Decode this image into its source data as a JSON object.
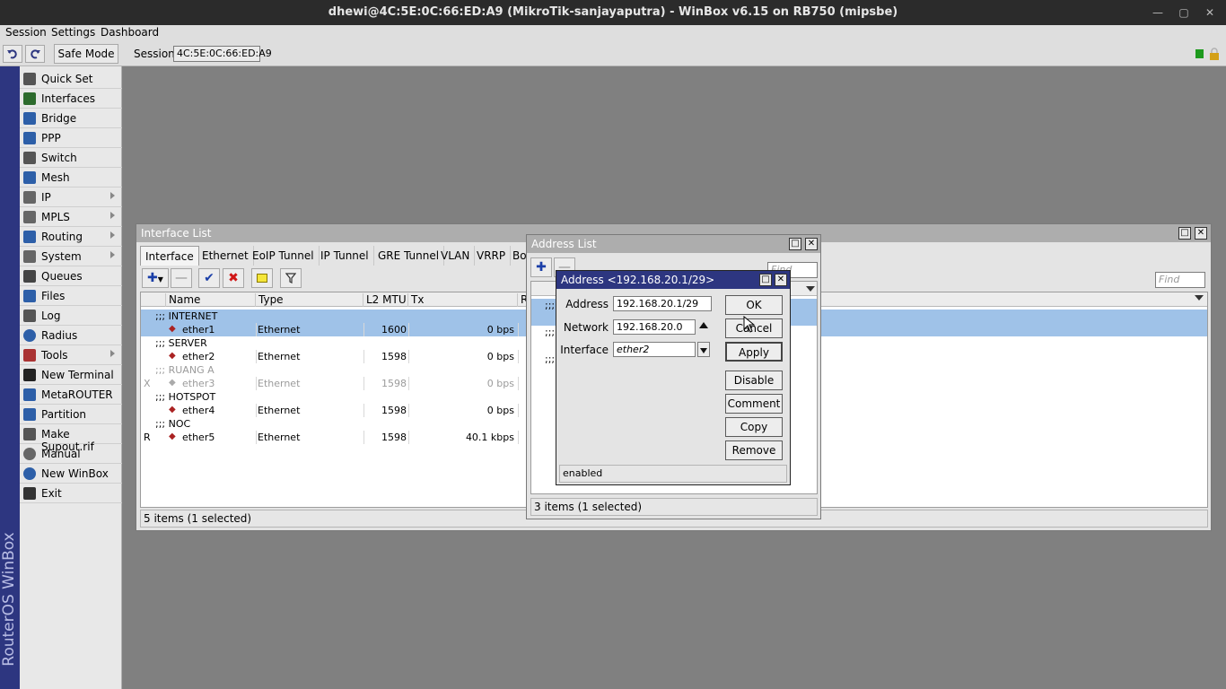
{
  "window": {
    "title": "dhewi@4C:5E:0C:66:ED:A9 (MikroTik-sanjayaputra) - WinBox v6.15 on RB750 (mipsbe)"
  },
  "menubar": [
    "Session",
    "Settings",
    "Dashboard"
  ],
  "toolbar": {
    "safe_mode": "Safe Mode",
    "session_label": "Session:",
    "session_value": "4C:5E:0C:66:ED:A9"
  },
  "sidebar": {
    "brand": "RouterOS WinBox",
    "items": [
      {
        "label": "Quick Set",
        "icon": "magic-wand-icon",
        "submenu": false
      },
      {
        "label": "Interfaces",
        "icon": "interfaces-icon",
        "submenu": false
      },
      {
        "label": "Bridge",
        "icon": "bridge-icon",
        "submenu": false
      },
      {
        "label": "PPP",
        "icon": "ppp-icon",
        "submenu": false
      },
      {
        "label": "Switch",
        "icon": "switch-icon",
        "submenu": false
      },
      {
        "label": "Mesh",
        "icon": "mesh-icon",
        "submenu": false
      },
      {
        "label": "IP",
        "icon": "ip-icon",
        "submenu": true
      },
      {
        "label": "MPLS",
        "icon": "mpls-icon",
        "submenu": true
      },
      {
        "label": "Routing",
        "icon": "routing-icon",
        "submenu": true
      },
      {
        "label": "System",
        "icon": "gear-icon",
        "submenu": true
      },
      {
        "label": "Queues",
        "icon": "queues-icon",
        "submenu": false
      },
      {
        "label": "Files",
        "icon": "folder-icon",
        "submenu": false
      },
      {
        "label": "Log",
        "icon": "log-icon",
        "submenu": false
      },
      {
        "label": "Radius",
        "icon": "radius-icon",
        "submenu": false
      },
      {
        "label": "Tools",
        "icon": "tools-icon",
        "submenu": true
      },
      {
        "label": "New Terminal",
        "icon": "terminal-icon",
        "submenu": false
      },
      {
        "label": "MetaROUTER",
        "icon": "metarouter-icon",
        "submenu": false
      },
      {
        "label": "Partition",
        "icon": "partition-icon",
        "submenu": false
      },
      {
        "label": "Make Supout.rif",
        "icon": "supout-icon",
        "submenu": false
      },
      {
        "label": "Manual",
        "icon": "manual-icon",
        "submenu": false
      },
      {
        "label": "New WinBox",
        "icon": "winbox-icon",
        "submenu": false
      },
      {
        "label": "Exit",
        "icon": "exit-icon",
        "submenu": false
      }
    ]
  },
  "interface_list": {
    "title": "Interface List",
    "tabs": [
      "Interface",
      "Ethernet",
      "EoIP Tunnel",
      "IP Tunnel",
      "GRE Tunnel",
      "VLAN",
      "VRRP",
      "Bo"
    ],
    "find_placeholder": "Find",
    "columns": [
      "Name",
      "Type",
      "L2 MTU",
      "Tx",
      "R"
    ],
    "rows": [
      {
        "kind": "comment",
        "text": ";;; INTERNET",
        "selected": true
      },
      {
        "kind": "data",
        "flag": "",
        "name": "ether1",
        "type": "Ethernet",
        "mtu": "1600",
        "tx": "0 bps",
        "selected": true,
        "disabled": false
      },
      {
        "kind": "comment",
        "text": ";;; SERVER",
        "selected": false
      },
      {
        "kind": "data",
        "flag": "",
        "name": "ether2",
        "type": "Ethernet",
        "mtu": "1598",
        "tx": "0 bps",
        "selected": false,
        "disabled": false
      },
      {
        "kind": "comment",
        "text": ";;; RUANG A",
        "selected": false,
        "disabled": true
      },
      {
        "kind": "data",
        "flag": "X",
        "name": "ether3",
        "type": "Ethernet",
        "mtu": "1598",
        "tx": "0 bps",
        "selected": false,
        "disabled": true
      },
      {
        "kind": "comment",
        "text": ";;; HOTSPOT",
        "selected": false
      },
      {
        "kind": "data",
        "flag": "",
        "name": "ether4",
        "type": "Ethernet",
        "mtu": "1598",
        "tx": "0 bps",
        "selected": false,
        "disabled": false
      },
      {
        "kind": "comment",
        "text": ";;; NOC",
        "selected": false
      },
      {
        "kind": "data",
        "flag": "R",
        "name": "ether5",
        "type": "Ethernet",
        "mtu": "1598",
        "tx": "40.1 kbps",
        "selected": false,
        "disabled": false
      }
    ],
    "status": "5 items (1 selected)"
  },
  "address_list": {
    "title": "Address List",
    "find_placeholder": "Find",
    "status": "3 items (1 selected)",
    "comment_marker": ";;;"
  },
  "address_dialog": {
    "title": "Address <192.168.20.1/29>",
    "address_label": "Address",
    "address_value": "192.168.20.1/29",
    "network_label": "Network",
    "network_value": "192.168.20.0",
    "interface_label": "Interface",
    "interface_value": "ether2",
    "buttons": [
      "OK",
      "Cancel",
      "Apply",
      "Disable",
      "Comment",
      "Copy",
      "Remove"
    ],
    "status": "enabled"
  }
}
